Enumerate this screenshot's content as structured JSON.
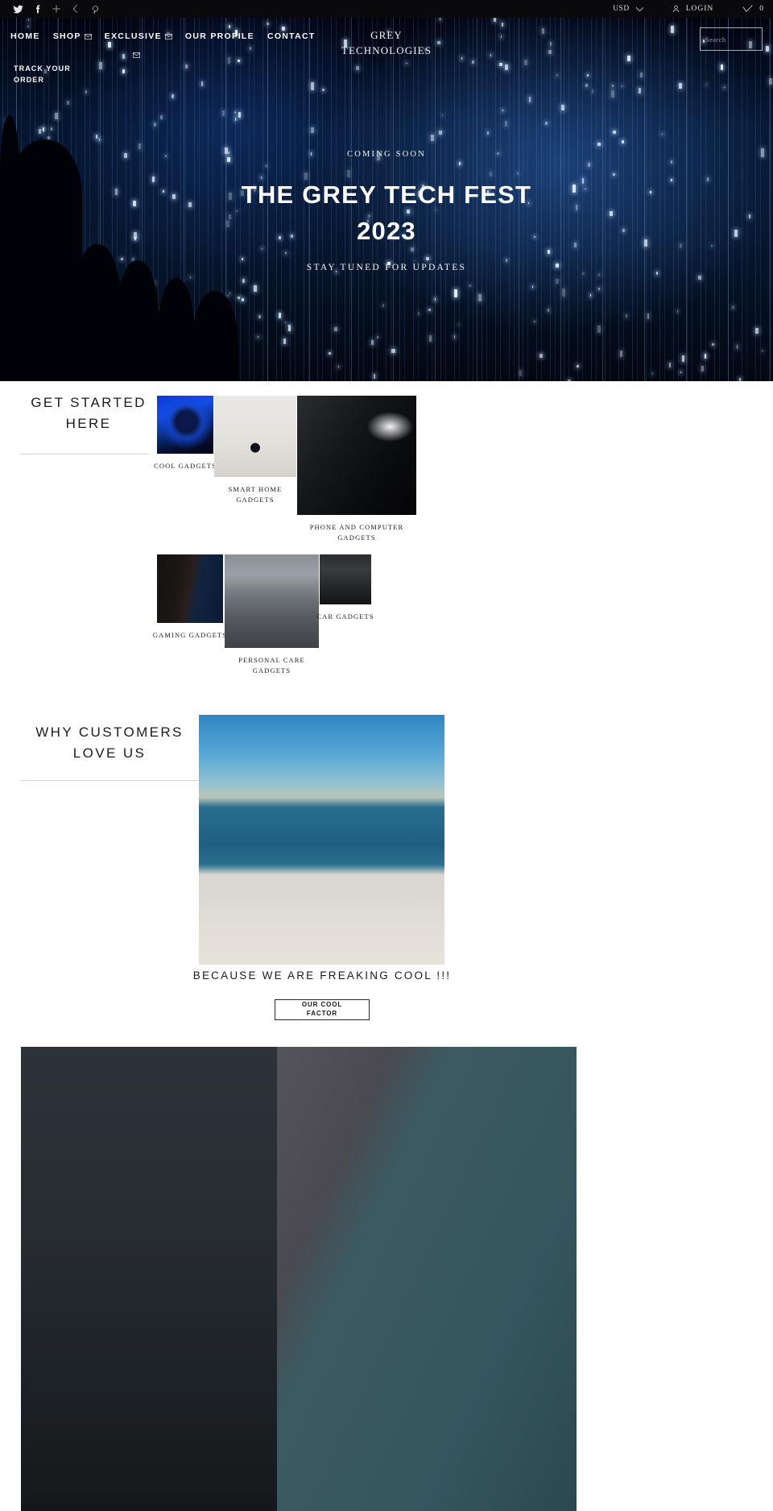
{
  "topbar": {
    "social": [
      {
        "name": "twitter-icon",
        "label": "Twitter"
      },
      {
        "name": "facebook-icon",
        "label": "Facebook"
      },
      {
        "name": "plus-icon",
        "label": "Share"
      },
      {
        "name": "chevron-left-icon",
        "label": "Previous"
      },
      {
        "name": "pinterest-icon",
        "label": "Pinterest"
      }
    ],
    "currency": "USD",
    "login_label": "LOGIN",
    "cart_count": "0"
  },
  "nav": {
    "items": [
      {
        "label": "HOME",
        "has_mail": false
      },
      {
        "label": "SHOP",
        "has_mail": true
      },
      {
        "label": "EXCLUSIVE",
        "has_mail": true
      },
      {
        "label": "OUR PROFILE",
        "has_mail": false
      },
      {
        "label": "CONTACT",
        "has_mail": false
      }
    ],
    "track_order": "TRACK YOUR ORDER",
    "logo_line1": "GREY",
    "logo_line2": "TECHNOLOGIES",
    "search_placeholder": "Search",
    "search_value": ""
  },
  "hero": {
    "eyebrow": "COMING SOON",
    "title_line1": "THE GREY TECH FEST",
    "title_line2": "2023",
    "subtitle": "STAY TUNED FOR UPDATES"
  },
  "get_started": {
    "heading": "GET STARTED HERE",
    "categories": [
      {
        "label": "COOL GADGETS",
        "image": "smartwatch-photo"
      },
      {
        "label": "SMART HOME GADGETS",
        "image": "thermostat-photo"
      },
      {
        "label": "PHONE AND COMPUTER GADGETS",
        "image": "laptop-mouse-photo"
      },
      {
        "label": "GAMING GADGETS",
        "image": "gaming-setup-photo"
      },
      {
        "label": "PERSONAL CARE GADGETS",
        "image": "fitness-woman-photo"
      },
      {
        "label": "CAR GADGETS",
        "image": "red-car-photo"
      }
    ]
  },
  "why": {
    "heading": "WHY CUSTOMERS LOVE US",
    "image": "man-laptop-seaside-photo",
    "caption": "BECAUSE WE ARE FREAKING COOL !!!",
    "button_line1": "OUR COOL",
    "button_line2": "FACTOR"
  },
  "bottom": {
    "left_image": "office-glass-meeting-photo",
    "right_image": "man-on-sofa-photo"
  },
  "colors": {
    "topbar_bg": "#0a0a0d",
    "hero_bg": "#061026",
    "text_dark": "#1b1b1b",
    "rule": "#d6d6d6",
    "white": "#ffffff"
  }
}
